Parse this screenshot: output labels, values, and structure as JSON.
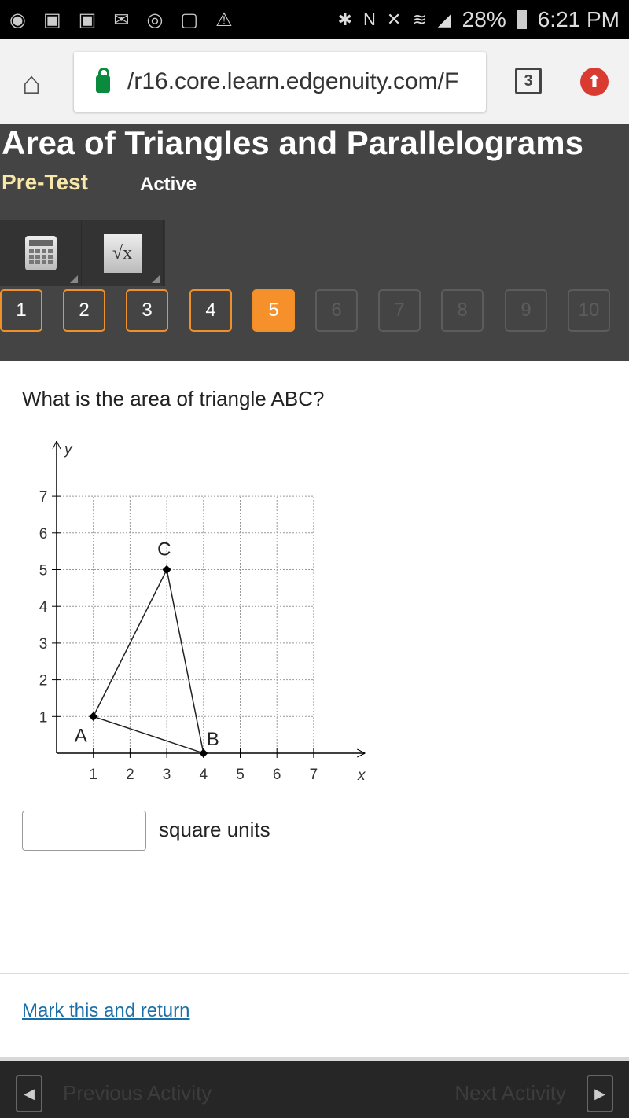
{
  "status_bar": {
    "notification_icons": [
      "messenger-icon",
      "facebook-icon",
      "facebook-icon",
      "email-icon",
      "instagram-icon",
      "gallery-icon",
      "warning-icon"
    ],
    "battery": "28%",
    "time": "6:21 PM"
  },
  "browser": {
    "url": "/r16.core.learn.edgenuity.com/F",
    "tab_count": "3"
  },
  "header": {
    "title": "Area of Triangles and Parallelograms",
    "subtitle": "Pre-Test",
    "status": "Active"
  },
  "questions": [
    {
      "label": "1",
      "state": "visited"
    },
    {
      "label": "2",
      "state": "visited"
    },
    {
      "label": "3",
      "state": "visited"
    },
    {
      "label": "4",
      "state": "visited"
    },
    {
      "label": "5",
      "state": "current"
    },
    {
      "label": "6",
      "state": "disabled"
    },
    {
      "label": "7",
      "state": "disabled"
    },
    {
      "label": "8",
      "state": "disabled"
    },
    {
      "label": "9",
      "state": "disabled"
    },
    {
      "label": "10",
      "state": "disabled"
    }
  ],
  "question": {
    "prompt": "What is the area of triangle ABC?",
    "answer_value": "",
    "units": "square units"
  },
  "graph": {
    "xlabel": "x",
    "ylabel": "y",
    "xticks": [
      "1",
      "2",
      "3",
      "4",
      "5",
      "6",
      "7"
    ],
    "yticks": [
      "1",
      "2",
      "3",
      "4",
      "5",
      "6",
      "7"
    ],
    "xlim": [
      0,
      7
    ],
    "ylim": [
      0,
      7
    ],
    "points": [
      {
        "label": "A",
        "x": 1,
        "y": 1
      },
      {
        "label": "B",
        "x": 4,
        "y": 0
      },
      {
        "label": "C",
        "x": 3,
        "y": 5
      }
    ]
  },
  "footer": {
    "mark_link": "Mark this and return",
    "previous": "Previous Activity",
    "next": "Next Activity"
  },
  "colors": {
    "accent": "#f5902a",
    "header_bg": "#444444",
    "link": "#1a6fa8"
  }
}
